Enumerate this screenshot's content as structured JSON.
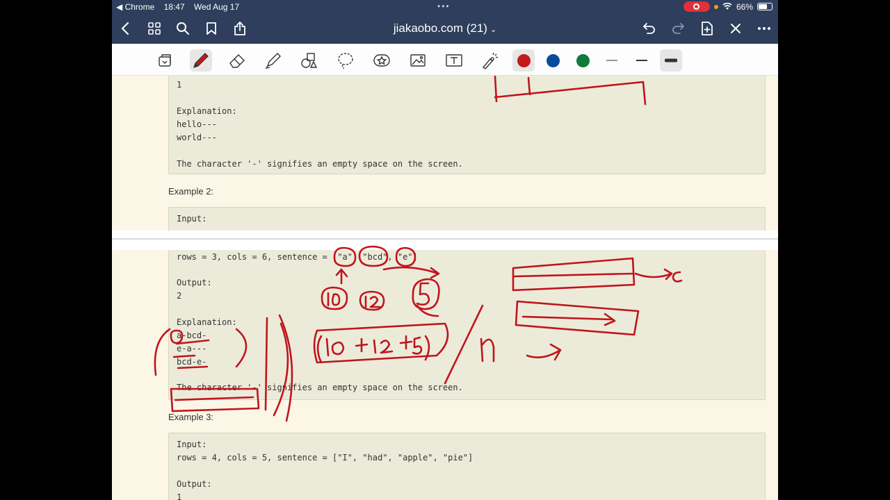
{
  "status_bar": {
    "back_app": "◀ Chrome",
    "time": "18:47",
    "date": "Wed Aug 17",
    "battery": "66%",
    "battery_level": 0.66
  },
  "nav": {
    "doc_title": "jiakaobo.com (21)",
    "icons": [
      "back-chevron-icon",
      "grid-icon",
      "search-icon",
      "bookmark-icon",
      "share-icon",
      "undo-icon",
      "redo-icon",
      "add-page-icon",
      "close-icon",
      "more-icon"
    ]
  },
  "toolbar": {
    "tools": [
      "read-only-icon",
      "pen-icon",
      "eraser-icon",
      "highlighter-icon",
      "shapes-icon",
      "lasso-icon",
      "stickers-icon",
      "image-icon",
      "text-icon",
      "laser-pointer-icon"
    ],
    "colors": [
      "#c41a1a",
      "#0a4a9c",
      "#0f7a3a"
    ],
    "selected_color": "#c41a1a",
    "accent": "#2e3e5c"
  },
  "page1": {
    "block1": [
      "1",
      "",
      "Explanation:",
      "hello---",
      "world---",
      "",
      "The character '-' signifies an empty space on the screen."
    ],
    "example2_heading": "Example 2:",
    "block2": [
      "Input:"
    ]
  },
  "page2": {
    "block2_cont": [
      "rows = 3, cols = 6, sentence = [\"a\", \"bcd\", \"e\"]",
      "",
      "Output:",
      "2",
      "",
      "Explanation:",
      "a-bcd-",
      "e-a---",
      "bcd-e-",
      "",
      "The character '-' signifies an empty space on the screen."
    ],
    "example3_heading": "Example 3:",
    "block3": [
      "Input:",
      "rows = 4, cols = 5, sentence = [\"I\", \"had\", \"apple\", \"pie\"]",
      "",
      "Output:",
      "1"
    ]
  },
  "ink_color": "#c0141e"
}
